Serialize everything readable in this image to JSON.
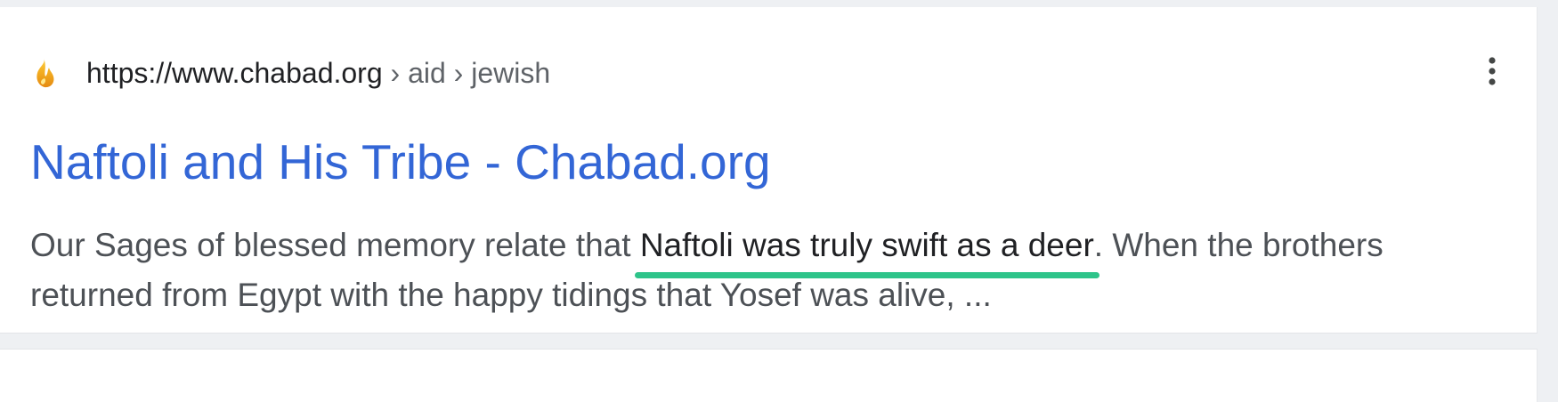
{
  "result": {
    "favicon_icon": "chabad-flame-icon",
    "url": {
      "domain": "https://www.chabad.org",
      "breadcrumb": " › aid › jewish"
    },
    "menu_icon": "vertical-dots-icon",
    "title": "Naftoli and His Tribe - Chabad.org",
    "snippet": {
      "before": "Our Sages of blessed memory relate that ",
      "highlight": "Naftoli was truly swift as a deer",
      "after": ". When the brothers returned from Egypt with the happy tidings that Yosef was alive, ..."
    }
  },
  "colors": {
    "title_link": "#3366d6",
    "highlight_underline": "#2ec48a",
    "snippet_text": "#4d5156"
  }
}
